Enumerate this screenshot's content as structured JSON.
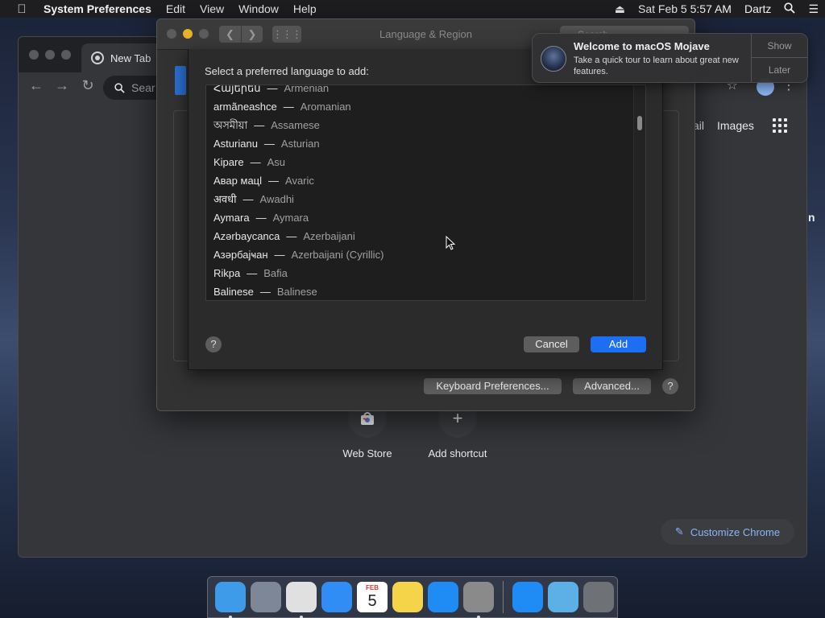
{
  "menubar": {
    "apple_icon": "apple-icon",
    "app_name": "System Preferences",
    "menus": [
      "Edit",
      "View",
      "Window",
      "Help"
    ],
    "date_time": "Sat Feb 5  5:57 AM",
    "user": "Dartz"
  },
  "chrome": {
    "tab_title": "New Tab",
    "omnibox_placeholder": "Sear",
    "links": [
      "ail",
      "Images"
    ],
    "right_edge_glyph": "n",
    "shortcuts": [
      {
        "label": "Web Store",
        "icon": "chrome-web-store-icon"
      },
      {
        "label": "Add shortcut",
        "icon": "plus-icon"
      }
    ],
    "customize_label": "Customize Chrome"
  },
  "syspref": {
    "window_title": "Language & Region",
    "search_placeholder": "Search",
    "keyboard_prefs_label": "Keyboard Preferences...",
    "advanced_label": "Advanced...",
    "help_label": "?"
  },
  "sheet": {
    "prompt": "Select a preferred language to add:",
    "languages": [
      {
        "native": "Հայերեն",
        "english": "Armenian"
      },
      {
        "native": "armãneashce",
        "english": "Aromanian"
      },
      {
        "native": "অসমীয়া",
        "english": "Assamese"
      },
      {
        "native": "Asturianu",
        "english": "Asturian"
      },
      {
        "native": "Kipare",
        "english": "Asu"
      },
      {
        "native": "Авар мацӏ",
        "english": "Avaric"
      },
      {
        "native": "अवधी",
        "english": "Awadhi"
      },
      {
        "native": "Aymara",
        "english": "Aymara"
      },
      {
        "native": "Azərbaycanca",
        "english": "Azerbaijani"
      },
      {
        "native": "Азәрбајҹан",
        "english": "Azerbaijani (Cyrillic)"
      },
      {
        "native": "Rikpa",
        "english": "Bafia"
      },
      {
        "native": "Balinese",
        "english": "Balinese"
      }
    ],
    "separator": "—",
    "help_label": "?",
    "cancel_label": "Cancel",
    "add_label": "Add"
  },
  "notification": {
    "title": "Welcome to macOS Mojave",
    "body": "Take a quick tour to learn about great new features.",
    "show_label": "Show",
    "later_label": "Later"
  },
  "dock": {
    "apps": [
      {
        "name": "Finder",
        "icon": "finder-icon",
        "color": "#3d9be9",
        "running": true
      },
      {
        "name": "Launchpad",
        "icon": "launchpad-icon",
        "color": "#7d8797",
        "running": false
      },
      {
        "name": "Chrome",
        "icon": "chrome-icon",
        "color": "#e0e0e0",
        "running": true
      },
      {
        "name": "Safari",
        "icon": "safari-icon",
        "color": "#2f8df5",
        "running": false
      },
      {
        "name": "Calendar",
        "icon": "calendar-icon",
        "color": "#ffffff",
        "running": false,
        "day": "5",
        "month": "FEB"
      },
      {
        "name": "Notes",
        "icon": "notes-icon",
        "color": "#f5d44a",
        "running": false
      },
      {
        "name": "App Store",
        "icon": "app-store-icon",
        "color": "#1e8cf4",
        "running": false
      },
      {
        "name": "System Preferences",
        "icon": "system-preferences-icon",
        "color": "#8a8a8a",
        "running": true
      },
      {
        "name": "App Store Downloads",
        "icon": "app-store-icon",
        "color": "#1e8cf4",
        "running": false
      },
      {
        "name": "Downloads",
        "icon": "downloads-folder-icon",
        "color": "#5cb0e6",
        "running": false
      },
      {
        "name": "Trash",
        "icon": "trash-icon",
        "color": "#6e7276",
        "running": false
      }
    ]
  }
}
